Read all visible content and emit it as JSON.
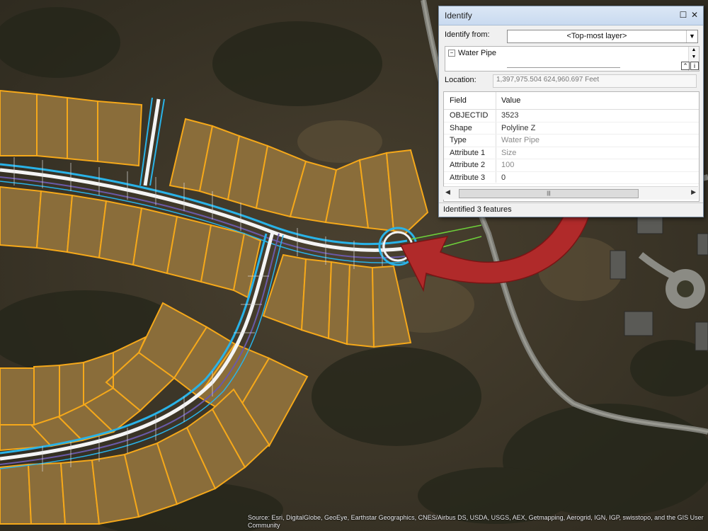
{
  "map": {
    "credits": "Source: Esri, DigitalGlobe, GeoEye, Earthstar Geographics, CNES/Airbus DS, USDA, USGS, AEX, Getmapping, Aerogrid, IGN, IGP, swisstopo, and the GIS User Community",
    "colors": {
      "parcel_fill": "#8a6d3a",
      "parcel_outline": "#f5a81a",
      "water_pipe": "#29b3e8",
      "road": "#f2f2f2",
      "arrow": "#b22a2a"
    }
  },
  "identify": {
    "title": "Identify",
    "identify_from_label": "Identify from:",
    "identify_from_value": "<Top-most layer>",
    "tree_node": "Water Pipe",
    "location_label": "Location:",
    "location_value": "1,397,975.504  624,960.697 Feet",
    "columns": [
      "Field",
      "Value"
    ],
    "rows": [
      {
        "field": "OBJECTID",
        "value": "3523"
      },
      {
        "field": "Shape",
        "value": "Polyline Z"
      },
      {
        "field": "Type",
        "value": "Water Pipe"
      },
      {
        "field": "Attribute 1",
        "value": "Size"
      },
      {
        "field": "Attribute 2",
        "value": "100"
      },
      {
        "field": "Attribute 3",
        "value": "0"
      }
    ],
    "status": "Identified 3 features"
  }
}
